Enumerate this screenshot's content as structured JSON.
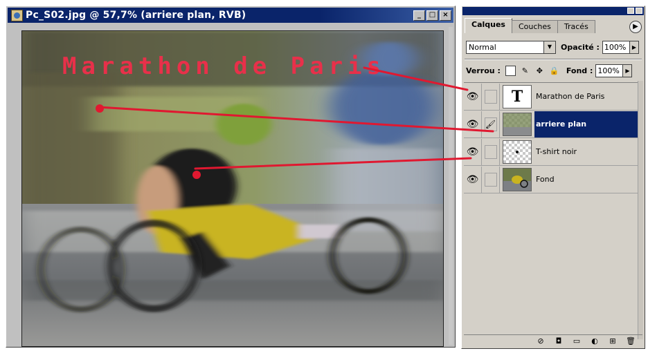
{
  "document": {
    "title": "Pc_S02.jpg @ 57,7% (arriere plan, RVB)",
    "window_buttons": [
      "_",
      "□",
      "×"
    ],
    "overlay_text": "Marathon de Paris",
    "overlay_color": "#e8304a",
    "pointer_line_color": "#e01830"
  },
  "layers_panel": {
    "tabs": [
      "Calques",
      "Couches",
      "Tracés"
    ],
    "active_tab": "Calques",
    "blend_mode": "Normal",
    "opacity_label": "Opacité :",
    "opacity_value": "100%",
    "lock_label": "Verrou :",
    "fill_label": "Fond :",
    "fill_value": "100%",
    "layers": [
      {
        "name": "Marathon de Paris",
        "thumb": "T",
        "visible": true,
        "selected": false
      },
      {
        "name": "arriere plan",
        "thumb": "",
        "visible": true,
        "selected": true,
        "brush": "🖌"
      },
      {
        "name": "T-shirt noir",
        "thumb": "",
        "visible": true,
        "selected": false
      },
      {
        "name": "Fond",
        "thumb": "",
        "visible": true,
        "selected": false
      }
    ],
    "icons": {
      "eye": "👁",
      "lock_transparent": "▢",
      "lock_paint": "✎",
      "lock_move": "✥",
      "lock_all": "🔒",
      "bottom": [
        "⊘",
        "◘",
        "▭",
        "◐",
        "⊞",
        "🗑"
      ]
    },
    "accent_selected": "#0a246a"
  }
}
